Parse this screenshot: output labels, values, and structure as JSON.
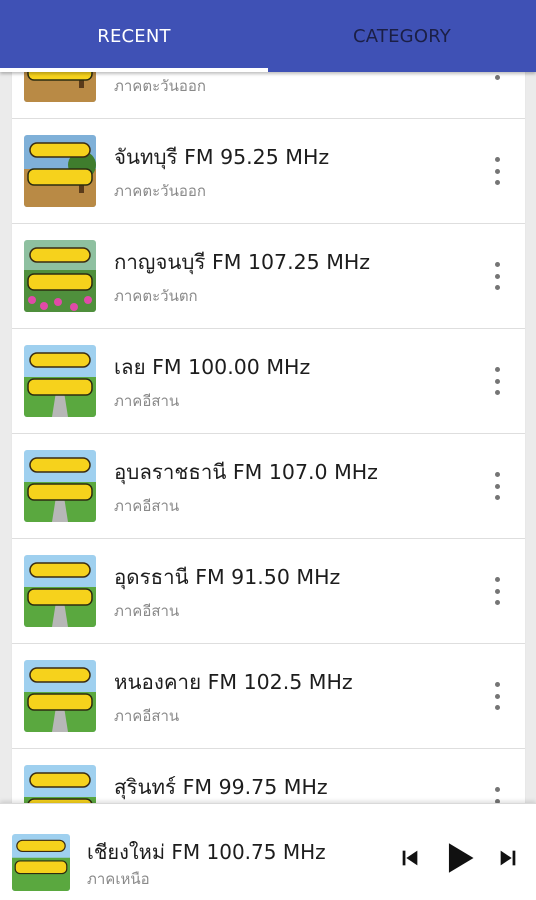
{
  "tabs": [
    {
      "label": "RECENT",
      "active": true
    },
    {
      "label": "CATEGORY",
      "active": false
    }
  ],
  "colors": {
    "primary": "#3f51b5",
    "indicator": "#ffffff"
  },
  "stations": [
    {
      "title": "",
      "subtitle": "ภาคตะวันออก",
      "badge": "ตะวันออก",
      "thumb_style": "east-tree"
    },
    {
      "title": "จันทบุรี FM 95.25 MHz",
      "subtitle": "ภาคตะวันออก",
      "badge": "ตะวันออก",
      "thumb_style": "east-tree"
    },
    {
      "title": "กาญจนบุรี FM 107.25 MHz",
      "subtitle": "ภาคตะวันตก",
      "badge": "ตะวันตก",
      "thumb_style": "west-flowers"
    },
    {
      "title": "เลย FM 100.00 MHz",
      "subtitle": "ภาคอีสาน",
      "badge": "อีสาน",
      "thumb_style": "isan-road"
    },
    {
      "title": "อุบลราชธานี FM 107.0 MHz",
      "subtitle": "ภาคอีสาน",
      "badge": "อีสาน",
      "thumb_style": "isan-road"
    },
    {
      "title": "อุดรธานี FM 91.50 MHz",
      "subtitle": "ภาคอีสาน",
      "badge": "อีสาน",
      "thumb_style": "isan-road"
    },
    {
      "title": "หนองคาย FM 102.5 MHz",
      "subtitle": "ภาคอีสาน",
      "badge": "อีสาน",
      "thumb_style": "isan-road"
    },
    {
      "title": "สุรินทร์ FM 99.75 MHz",
      "subtitle": "ภาคอีสาน",
      "badge": "อีสาน",
      "thumb_style": "isan-road"
    }
  ],
  "player": {
    "title": "เชียงใหม่ FM 100.75 MHz",
    "subtitle": "ภาคเหนือ",
    "badge": "เหนือ",
    "thumb_style": "north",
    "icons": {
      "prev": "skip-previous-icon",
      "play": "play-icon",
      "next": "skip-next-icon"
    }
  }
}
